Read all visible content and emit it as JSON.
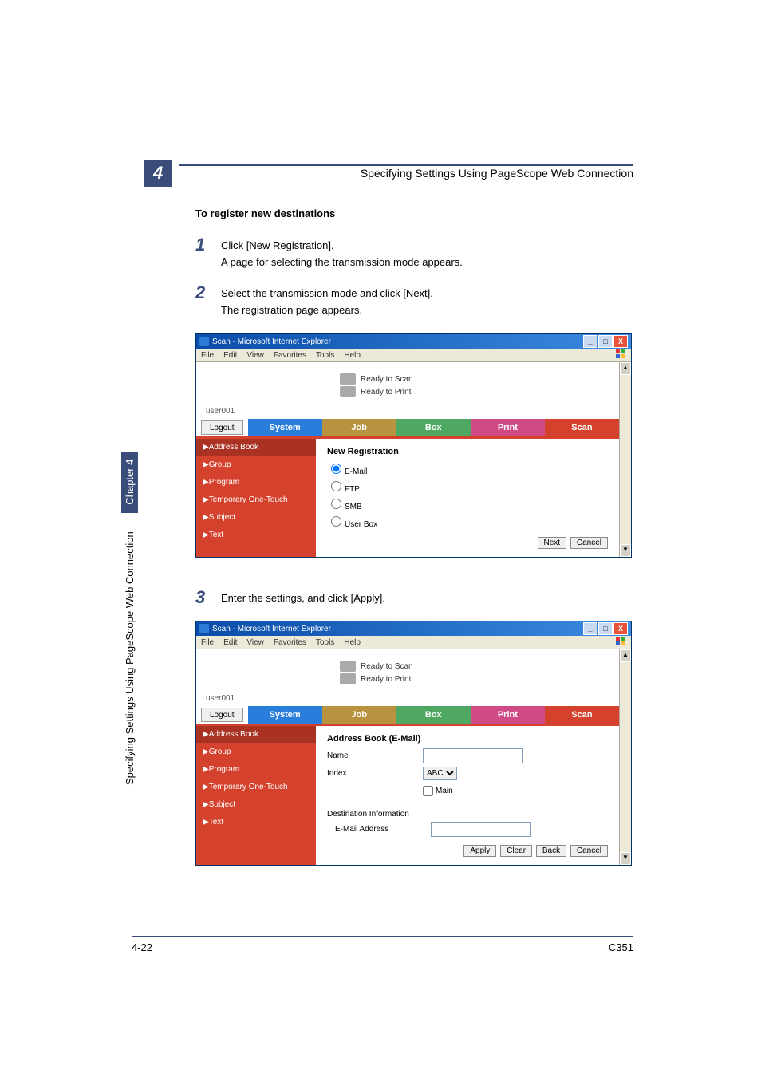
{
  "header": {
    "chapter_num": "4",
    "title": "Specifying Settings Using PageScope Web Connection"
  },
  "section_title": "To register new destinations",
  "steps": {
    "s1": {
      "num": "1",
      "line1": "Click [New Registration].",
      "line2": "A page for selecting the transmission mode appears."
    },
    "s2": {
      "num": "2",
      "line1": "Select the transmission mode and click [Next].",
      "line2": "The registration page appears."
    },
    "s3": {
      "num": "3",
      "line1": "Enter the settings, and click [Apply]."
    }
  },
  "ie": {
    "title": "Scan - Microsoft Internet Explorer",
    "menu": {
      "file": "File",
      "edit": "Edit",
      "view": "View",
      "favorites": "Favorites",
      "tools": "Tools",
      "help": "Help"
    },
    "win": {
      "min": "_",
      "max": "□",
      "close": "X"
    },
    "status": {
      "scan": "Ready to Scan",
      "print": "Ready to Print"
    },
    "user": "user001",
    "logout": "Logout",
    "tabs": {
      "system": "System",
      "job": "Job",
      "box": "Box",
      "print": "Print",
      "scan": "Scan"
    },
    "side": {
      "addr": "▶Address Book",
      "group": "▶Group",
      "program": "▶Program",
      "temp": "▶Temporary One-Touch",
      "subject": "▶Subject",
      "text": "▶Text"
    }
  },
  "win1": {
    "heading": "New Registration",
    "opt_email": "E-Mail",
    "opt_ftp": "FTP",
    "opt_smb": "SMB",
    "opt_userbox": "User Box",
    "btn_next": "Next",
    "btn_cancel": "Cancel"
  },
  "win2": {
    "heading": "Address Book (E-Mail)",
    "lbl_name": "Name",
    "lbl_index": "Index",
    "index_val": "ABC",
    "chk_main": "Main",
    "lbl_destinfo": "Destination Information",
    "lbl_email": "E-Mail Address",
    "btn_apply": "Apply",
    "btn_clear": "Clear",
    "btn_back": "Back",
    "btn_cancel": "Cancel"
  },
  "sidetext": {
    "label": "Specifying Settings Using PageScope Web Connection",
    "chapter": "Chapter 4"
  },
  "footer": {
    "page": "4-22",
    "model": "C351"
  }
}
